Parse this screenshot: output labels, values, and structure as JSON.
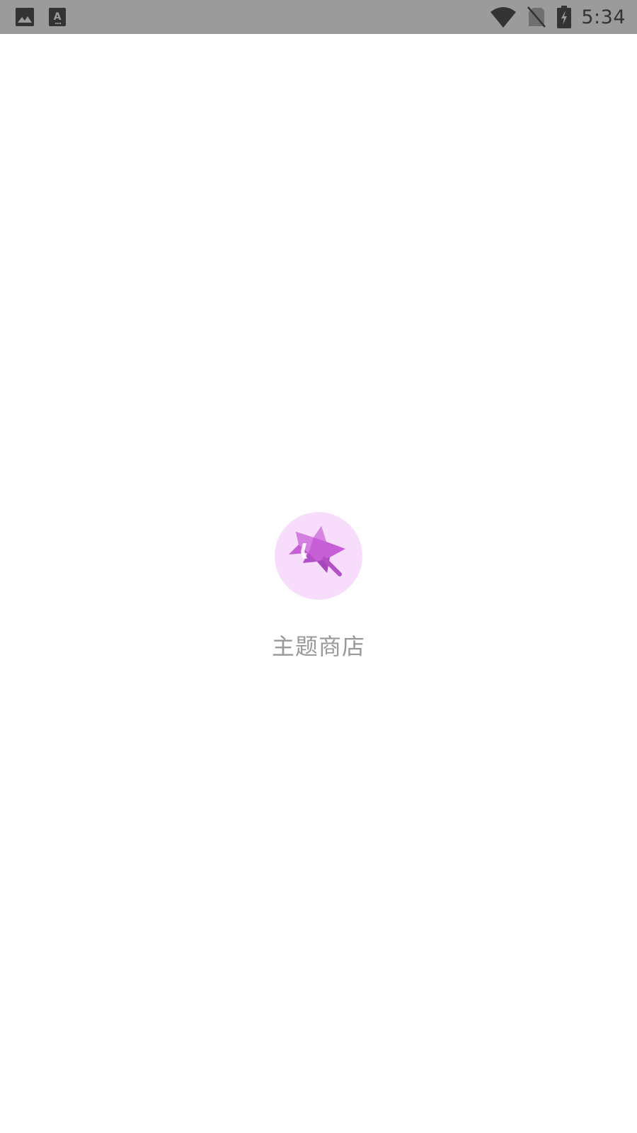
{
  "status_bar": {
    "time": "5:34",
    "left_icons": [
      "image-icon",
      "keyboard-a-icon"
    ],
    "right_icons": [
      "wifi-icon",
      "no-sim-icon",
      "battery-charging-icon"
    ],
    "background": "#9b9b9b"
  },
  "splash": {
    "app_name": "主题商店",
    "logo_icon": "star-pointer-icon",
    "logo_bg_color": "#f8dcfc",
    "logo_star_color": "#c65fd6",
    "text_color": "#999999"
  }
}
